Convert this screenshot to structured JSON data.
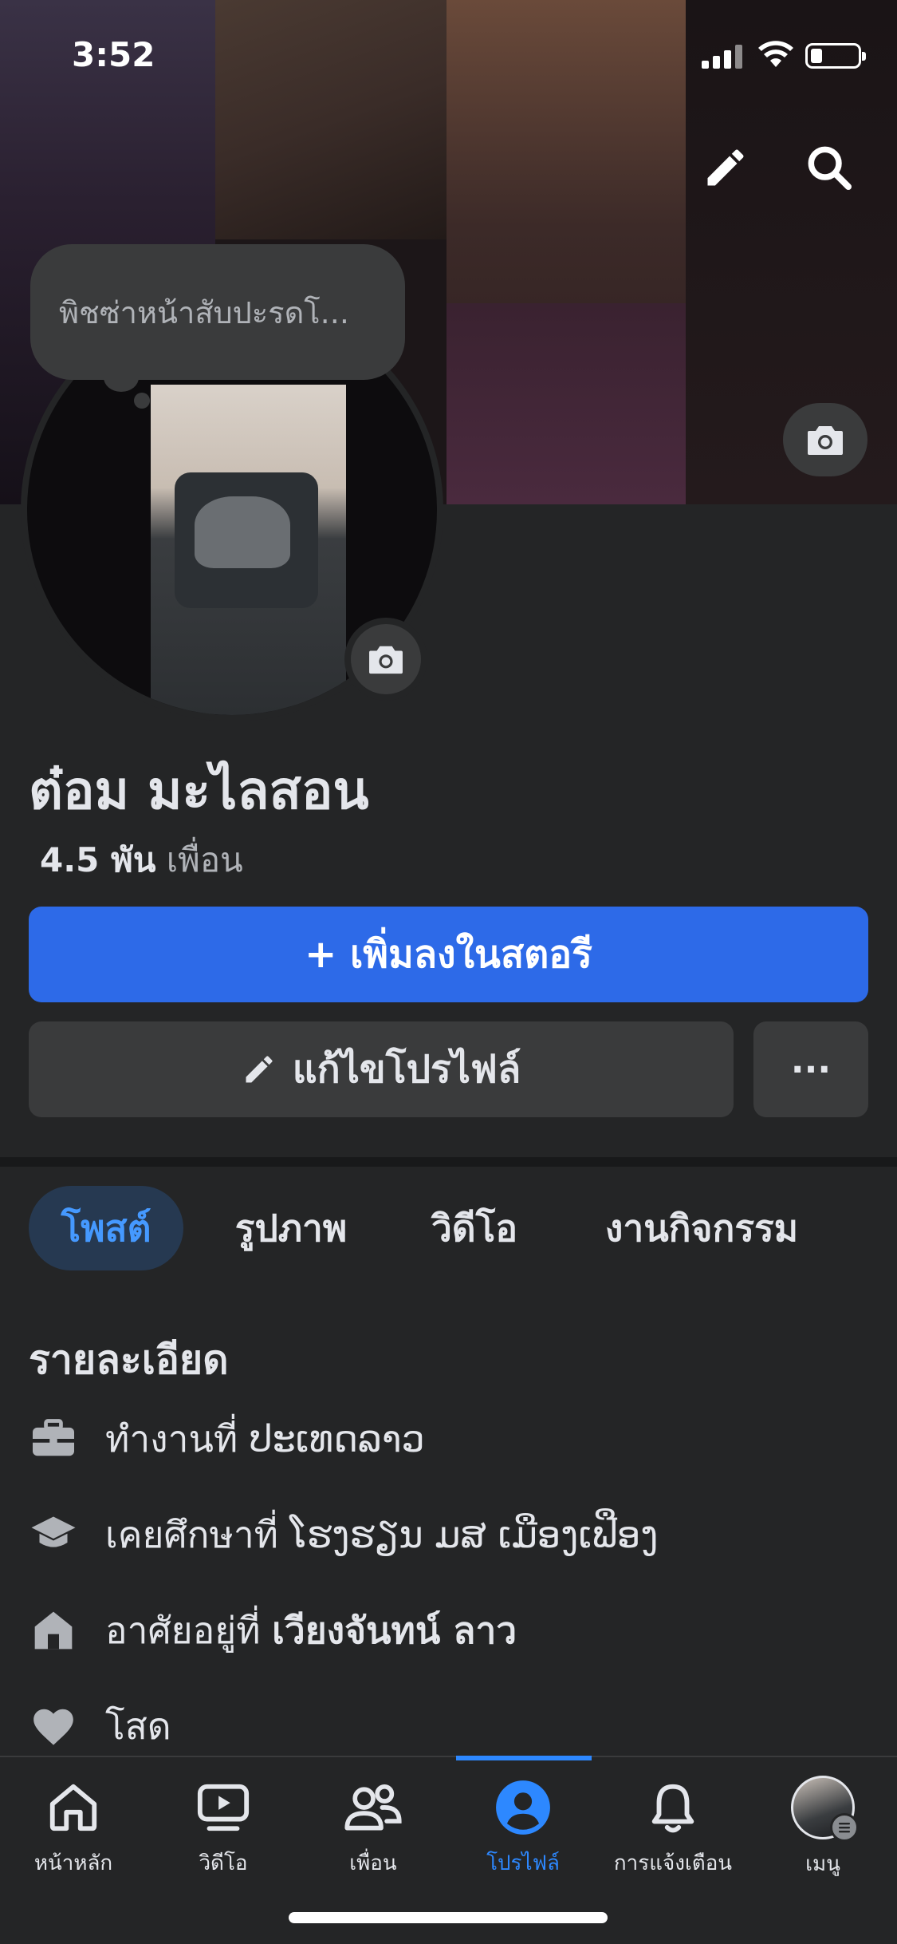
{
  "status_bar": {
    "time": "3:52"
  },
  "profile": {
    "note_bubble": "พิชซ่าหน้าสับปะรดโ...",
    "name": "ต๋อม มะไลสอน",
    "friends_count": "4.5 พัน",
    "friends_label": "เพื่อน"
  },
  "actions": {
    "add_story": "+ เพิ่มลงในสตอรี",
    "edit_profile": "แก้ไขโปรไฟล์",
    "more": "···"
  },
  "tabs": [
    {
      "label": "โพสต์",
      "active": true
    },
    {
      "label": "รูปภาพ",
      "active": false
    },
    {
      "label": "วิดีโอ",
      "active": false
    },
    {
      "label": "งานกิจกรรม",
      "active": false
    }
  ],
  "details": {
    "title": "รายละเอียด",
    "work_prefix": "ทำงานที่",
    "work_value": "ປະເທດລາວ",
    "education_prefix": "เคยศึกษาที่",
    "education_value": "ໂຮງຮຽນ ມສ ເມືອງເຟືອງ",
    "lives_prefix": "อาศัยอยู่ที่",
    "lives_value": "เวียงจันทน์ ลาว",
    "relationship": "โสด"
  },
  "bottom_nav": [
    {
      "label": "หน้าหลัก",
      "icon": "home-icon",
      "active": false
    },
    {
      "label": "วิดีโอ",
      "icon": "video-icon",
      "active": false
    },
    {
      "label": "เพื่อน",
      "icon": "friends-icon",
      "active": false
    },
    {
      "label": "โปรไฟล์",
      "icon": "profile-icon",
      "active": true
    },
    {
      "label": "การแจ้งเตือน",
      "icon": "bell-icon",
      "active": false
    },
    {
      "label": "เมนู",
      "icon": "menu-avatar-icon",
      "active": false
    }
  ],
  "colors": {
    "background": "#242526",
    "accent": "#2d6ae8",
    "active_tab_text": "#4599ff",
    "text_primary": "#e4e6eb",
    "text_secondary": "#b0b3b8"
  }
}
